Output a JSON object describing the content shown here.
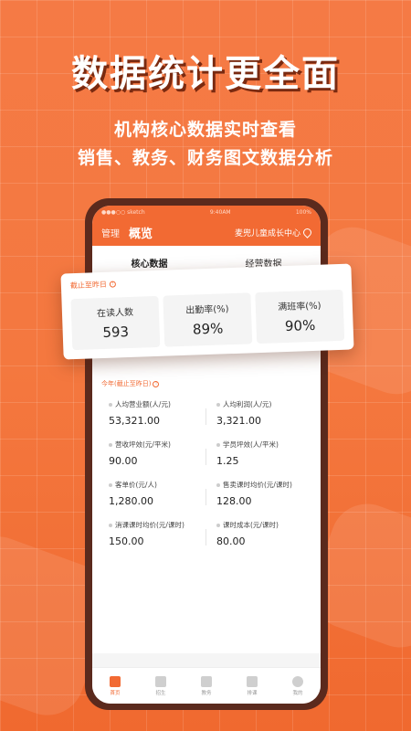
{
  "promo": {
    "headline": "数据统计更全面",
    "sub1": "机构核心数据实时查看",
    "sub2": "销售、教务、财务图文数据分析"
  },
  "statusbar": {
    "carrier": "●●●○○ sketch",
    "time": "9:40AM",
    "battery": "100%"
  },
  "appbar": {
    "menu": "管理",
    "title": "概览",
    "org": "麦兜儿童成长中心"
  },
  "tabs": [
    {
      "label": "核心数据",
      "active": true
    },
    {
      "label": "经营数据",
      "active": false
    }
  ],
  "core": {
    "label": "截止至昨日",
    "metrics": [
      {
        "label": "在读人数",
        "value": "593"
      },
      {
        "label": "出勤率(%)",
        "value": "89%"
      },
      {
        "label": "满班率(%)",
        "value": "90%"
      }
    ]
  },
  "yearly": {
    "label": "今年(截止至昨日)",
    "items": [
      {
        "label": "人均营业额(人/元)",
        "value": "53,321.00"
      },
      {
        "label": "人均利润(人/元)",
        "value": "3,321.00"
      },
      {
        "label": "营收坪效(元/平米)",
        "value": "90.00"
      },
      {
        "label": "学员坪效(人/平米)",
        "value": "1.25"
      },
      {
        "label": "客单价(元/人)",
        "value": "1,280.00"
      },
      {
        "label": "售卖课时均价(元/课时)",
        "value": "128.00"
      },
      {
        "label": "消课课时均价(元/课时)",
        "value": "150.00"
      },
      {
        "label": "课时成本(元/课时)",
        "value": "80.00"
      }
    ]
  },
  "tabbar": [
    {
      "label": "首页",
      "icon": "home-icon",
      "active": true
    },
    {
      "label": "招生",
      "icon": "enroll-icon",
      "active": false
    },
    {
      "label": "教务",
      "icon": "teaching-icon",
      "active": false
    },
    {
      "label": "排课",
      "icon": "schedule-icon",
      "active": false
    },
    {
      "label": "我的",
      "icon": "profile-icon",
      "active": false
    }
  ],
  "colors": {
    "accent": "#f26a33",
    "dark": "#5b2a1d"
  }
}
